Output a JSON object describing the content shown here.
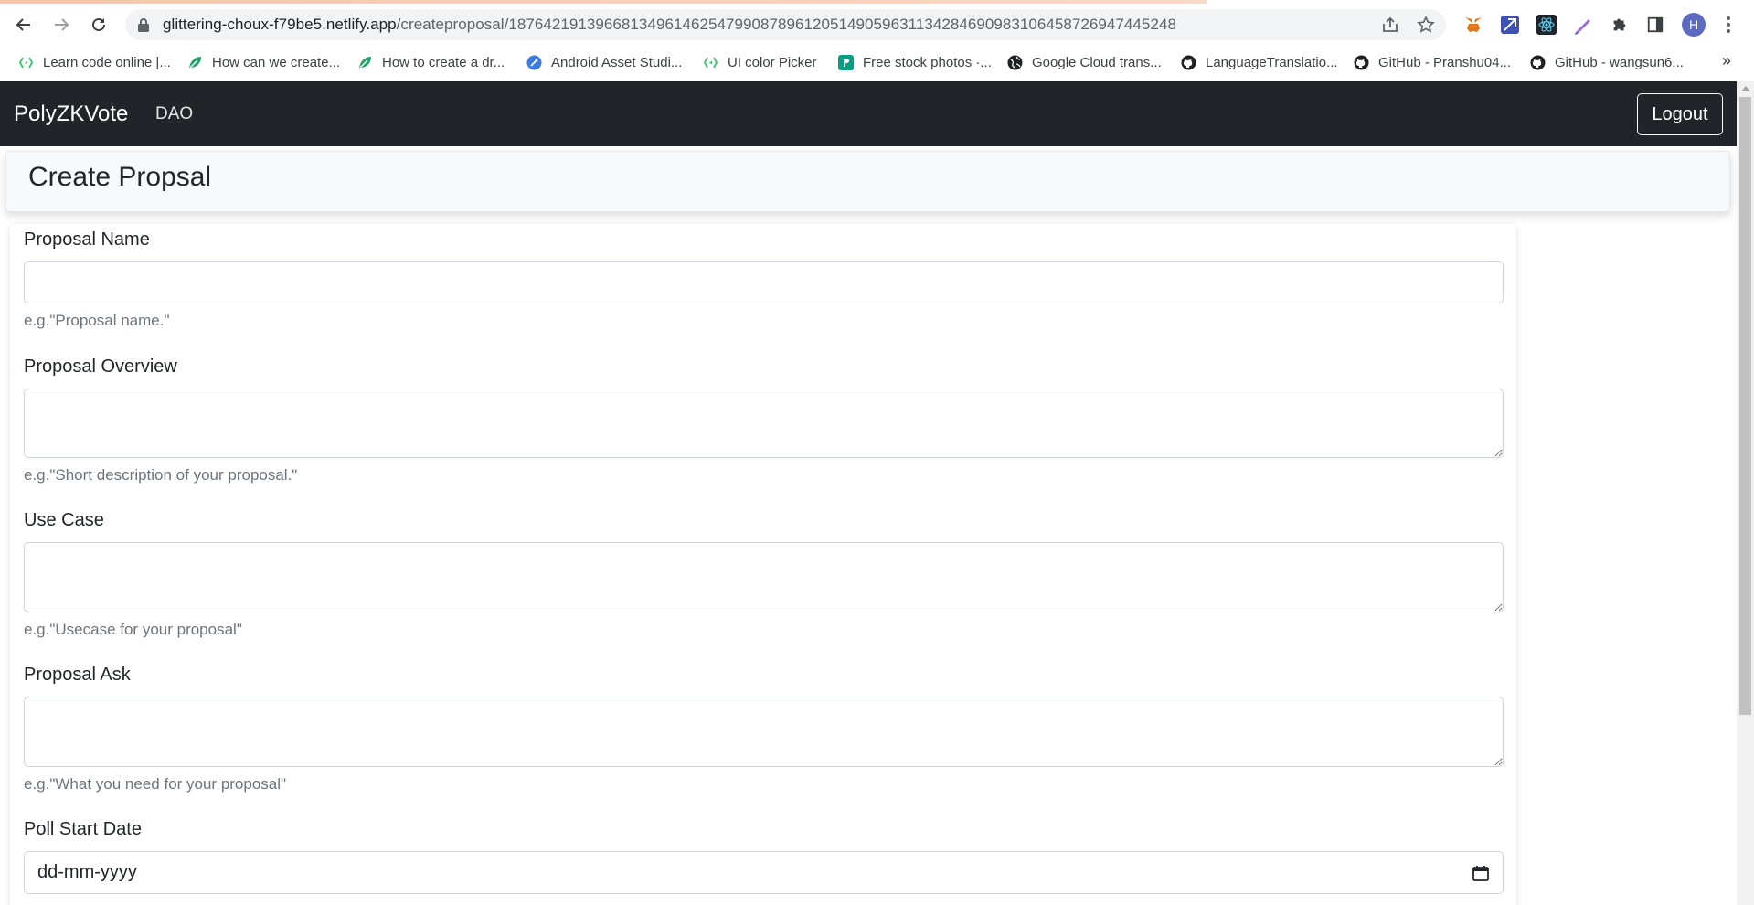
{
  "browser": {
    "url_host": "glittering-choux-f79be5.netlify.app",
    "url_path": "/createproposal/18764219139668134961462547990878961205149059631134284690983106458726947445248",
    "profile_initial": "H",
    "bookmarks": [
      {
        "label": "Learn code online |..."
      },
      {
        "label": "How can we create..."
      },
      {
        "label": "How to create a dr..."
      },
      {
        "label": "Android Asset Studi..."
      },
      {
        "label": "UI color Picker"
      },
      {
        "label": "Free stock photos ·..."
      },
      {
        "label": "Google Cloud trans..."
      },
      {
        "label": "LanguageTranslatio..."
      },
      {
        "label": "GitHub - Pranshu04..."
      },
      {
        "label": "GitHub - wangsun6..."
      }
    ],
    "more_bookmarks": "»"
  },
  "navbar": {
    "brand": "PolyZKVote",
    "link": "DAO",
    "logout": "Logout"
  },
  "header": {
    "title": "Create Propsal"
  },
  "form": {
    "fields": [
      {
        "label": "Proposal Name",
        "value": "",
        "help": "e.g.\"Proposal name.\""
      },
      {
        "label": "Proposal Overview",
        "value": "",
        "help": "e.g.\"Short description of your proposal.\""
      },
      {
        "label": "Use Case",
        "value": "",
        "help": "e.g.\"Usecase for your proposal\""
      },
      {
        "label": "Proposal Ask",
        "value": "",
        "help": "e.g.\"What you need for your proposal\""
      },
      {
        "label": "Poll Start Date",
        "placeholder": "dd-mm-yyyy"
      }
    ]
  }
}
